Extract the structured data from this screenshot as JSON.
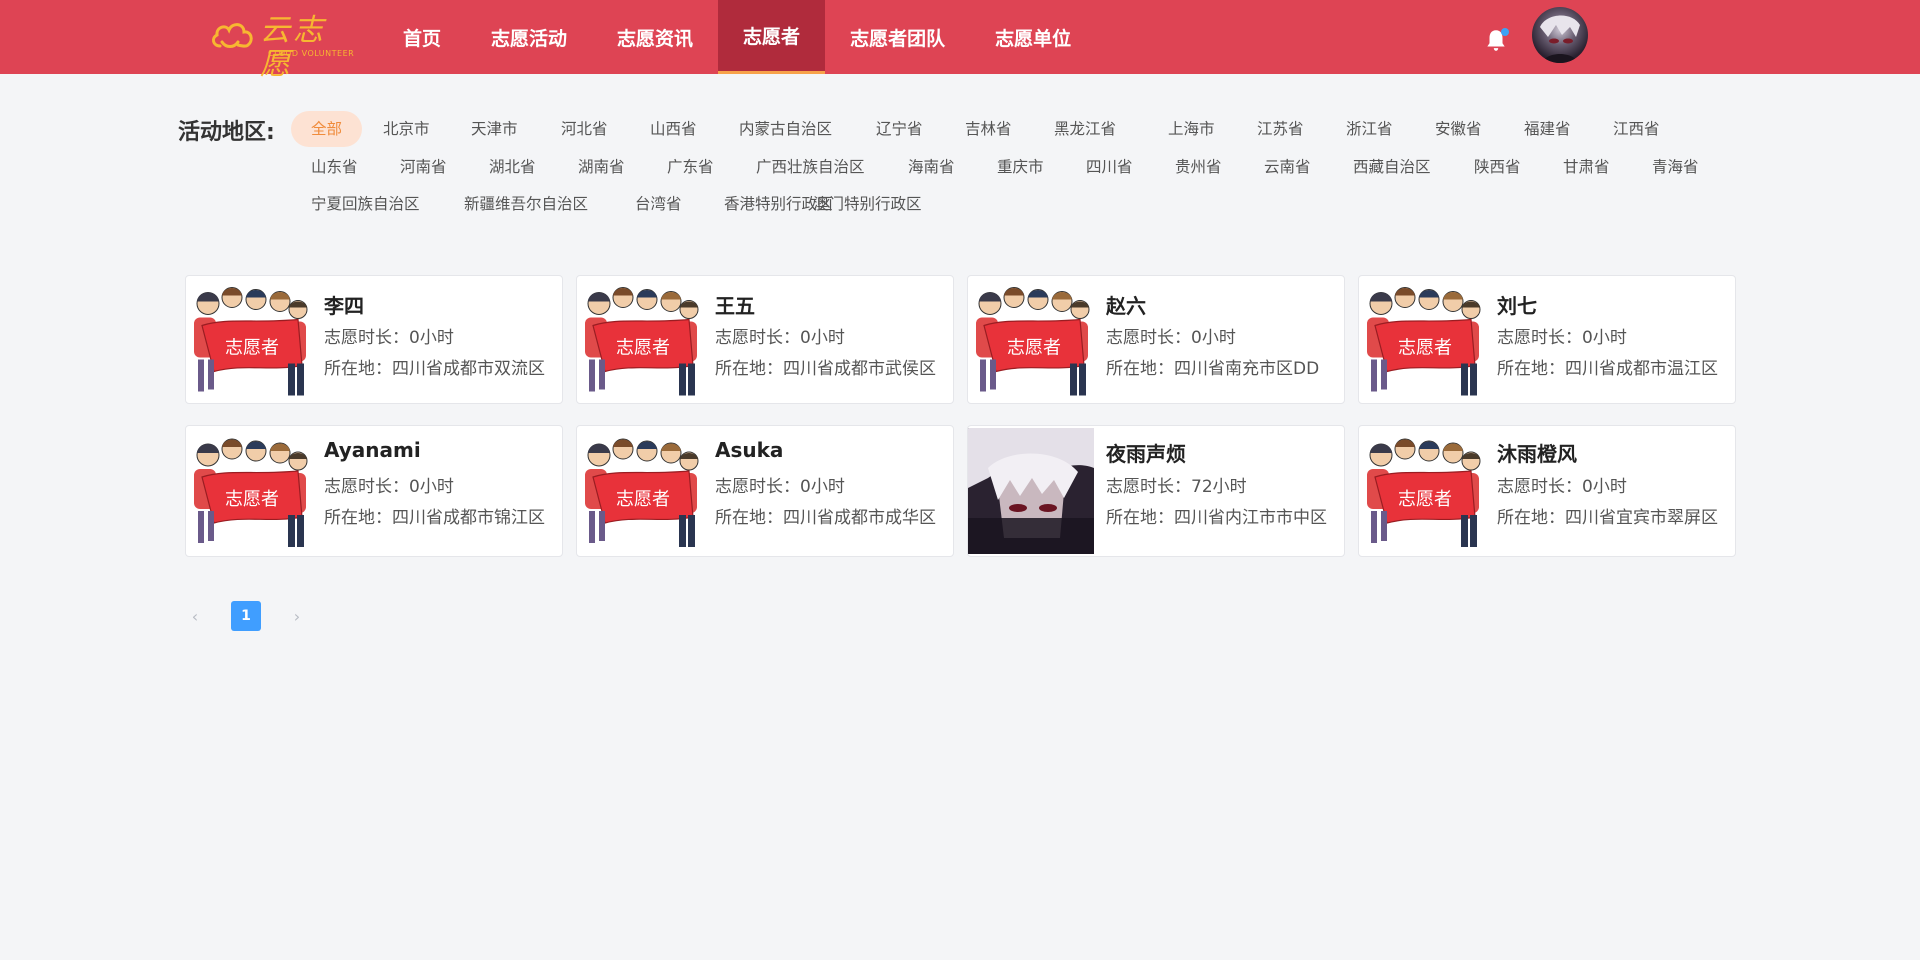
{
  "brand": {
    "logo_cn": "云志愿",
    "logo_en": "CLOUD VOLUNTEER",
    "color": "#f7b731"
  },
  "header": {
    "nav": [
      {
        "label": "首页",
        "active": false
      },
      {
        "label": "志愿活动",
        "active": false
      },
      {
        "label": "志愿资讯",
        "active": false
      },
      {
        "label": "志愿者",
        "active": true
      },
      {
        "label": "志愿者团队",
        "active": false
      },
      {
        "label": "志愿单位",
        "active": false
      }
    ],
    "colors": {
      "bar": "#de4454",
      "active_tab": "#b02b3c",
      "active_underline": "#f7a24a"
    },
    "icons": {
      "notification": "bell-icon",
      "avatar": "user-avatar"
    }
  },
  "filter": {
    "label": "活动地区:",
    "regions": [
      "全部",
      "北京市",
      "天津市",
      "河北省",
      "山西省",
      "内蒙古自治区",
      "辽宁省",
      "吉林省",
      "黑龙江省",
      "上海市",
      "江苏省",
      "浙江省",
      "安徽省",
      "福建省",
      "江西省",
      "山东省",
      "河南省",
      "湖北省",
      "湖南省",
      "广东省",
      "广西壮族自治区",
      "海南省",
      "重庆市",
      "四川省",
      "贵州省",
      "云南省",
      "西藏自治区",
      "陕西省",
      "甘肃省",
      "青海省",
      "宁夏回族自治区",
      "新疆维吾尔自治区",
      "台湾省",
      "香港特别行政区",
      "澳门特别行政区"
    ],
    "selected": "全部"
  },
  "volunteers": [
    {
      "name": "李四",
      "hours": "志愿时长：0小时",
      "location": "所在地：四川省成都市双流区",
      "image": "volunteer-banner"
    },
    {
      "name": "王五",
      "hours": "志愿时长：0小时",
      "location": "所在地：四川省成都市武侯区",
      "image": "volunteer-banner"
    },
    {
      "name": "赵六",
      "hours": "志愿时长：0小时",
      "location": "所在地：四川省南充市区DD",
      "image": "volunteer-banner"
    },
    {
      "name": "刘七",
      "hours": "志愿时长：0小时",
      "location": "所在地：四川省成都市温江区",
      "image": "volunteer-banner"
    },
    {
      "name": "Ayanami",
      "hours": "志愿时长：0小时",
      "location": "所在地：四川省成都市锦江区",
      "image": "volunteer-banner"
    },
    {
      "name": "Asuka",
      "hours": "志愿时长：0小时",
      "location": "所在地：四川省成都市成华区",
      "image": "volunteer-banner"
    },
    {
      "name": "夜雨声烦",
      "hours": "志愿时长：72小时",
      "location": "所在地：四川省内江市市中区",
      "image": "anime-portrait"
    },
    {
      "name": "沐雨橙风",
      "hours": "志愿时长：0小时",
      "location": "所在地：四川省宜宾市翠屏区",
      "image": "volunteer-banner"
    }
  ],
  "pagination": {
    "current": "1",
    "prev_icon": "chevron-left-icon",
    "next_icon": "chevron-right-icon"
  }
}
